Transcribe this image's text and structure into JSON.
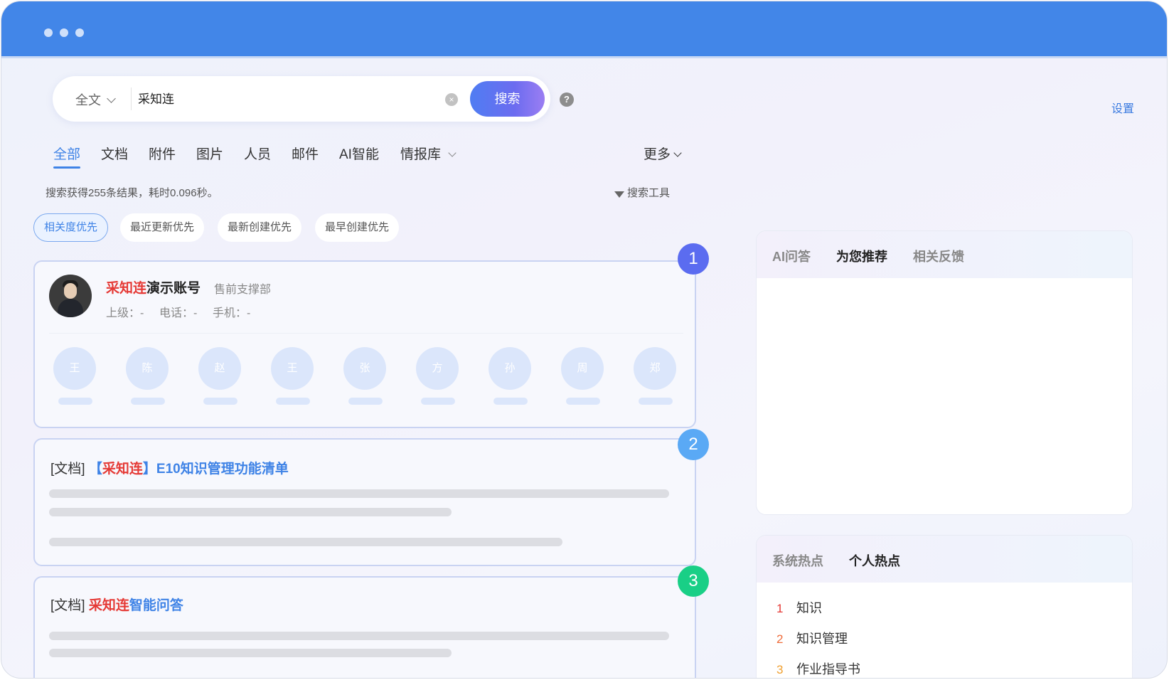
{
  "window": {
    "dots": 3
  },
  "search": {
    "scope_label": "全文",
    "query": "采知连",
    "button_label": "搜索",
    "help_glyph": "?",
    "clear_glyph": "×"
  },
  "header": {
    "settings_label": "设置"
  },
  "tabs": [
    {
      "label": "全部",
      "active": true
    },
    {
      "label": "文档"
    },
    {
      "label": "附件"
    },
    {
      "label": "图片"
    },
    {
      "label": "人员"
    },
    {
      "label": "邮件"
    },
    {
      "label": "AI智能"
    },
    {
      "label": "情报库"
    },
    {
      "label": "更多"
    }
  ],
  "results_summary": "搜索获得255条结果，耗时0.096秒。",
  "search_tools_label": "搜索工具",
  "sort_options": [
    {
      "label": "相关度优先",
      "active": true
    },
    {
      "label": "最近更新优先"
    },
    {
      "label": "最新创建优先"
    },
    {
      "label": "最早创建优先"
    }
  ],
  "results": {
    "person": {
      "badge": "1",
      "name_highlight": "采知连",
      "name_rest": "演示账号",
      "department": "售前支撑部",
      "superior": "上级：-",
      "phone": "电话：-",
      "mobile": "手机：-",
      "colleagues": [
        "王",
        "陈",
        "赵",
        "王",
        "张",
        "方",
        "孙",
        "周",
        "郑"
      ]
    },
    "doc1": {
      "badge": "2",
      "prefix": "[文档]",
      "bracket_open": "【",
      "highlight": "采知连",
      "bracket_close": "】",
      "title_rest": "E10知识管理功能清单"
    },
    "doc2": {
      "badge": "3",
      "prefix": "[文档]",
      "highlight": "采知连",
      "title_rest": "智能问答"
    }
  },
  "right_panel": {
    "top_tabs": [
      "AI问答",
      "为您推荐",
      "相关反馈"
    ],
    "top_active": "为您推荐",
    "hot_tabs": [
      "系统热点",
      "个人热点"
    ],
    "hot_active": "个人热点",
    "hot_items": [
      {
        "rank": "1",
        "label": "知识",
        "color": "#e53935"
      },
      {
        "rank": "2",
        "label": "知识管理",
        "color": "#ef6c3a"
      },
      {
        "rank": "3",
        "label": "作业指导书",
        "color": "#f0a030"
      }
    ]
  },
  "colors": {
    "titlebar": "#4286e8",
    "accent": "#3f83e6",
    "highlight": "#e53935",
    "badge_1": "#5b6cf0",
    "badge_2": "#5aa9f5",
    "badge_3": "#19cf86"
  }
}
